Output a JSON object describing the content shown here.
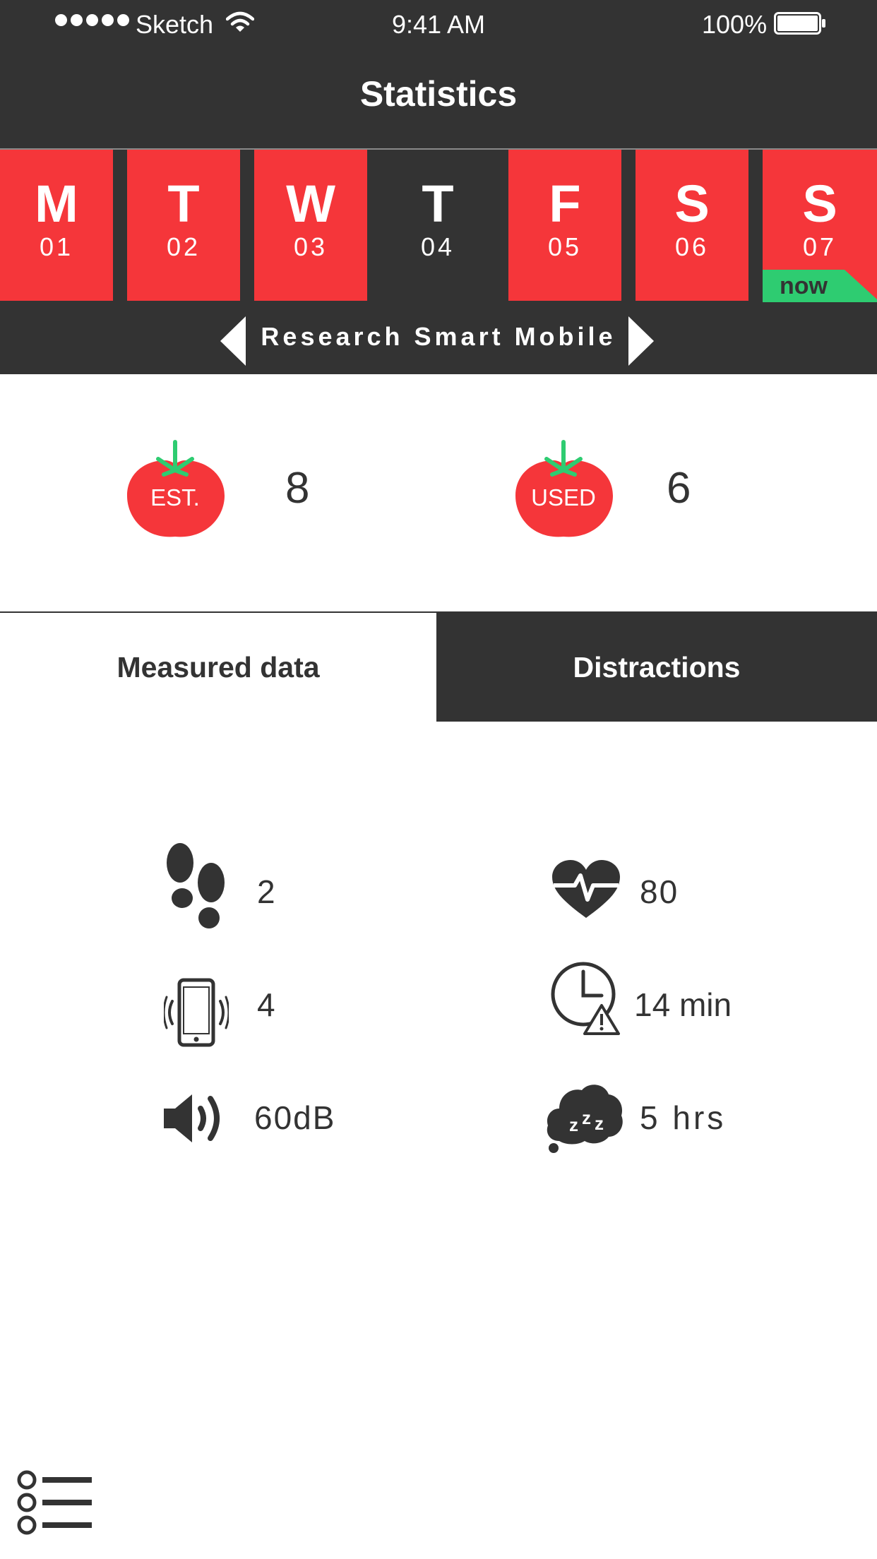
{
  "colors": {
    "dark": "#333333",
    "accent_red": "#f5363a",
    "now_green": "#2ecc71",
    "white": "#ffffff"
  },
  "status_bar": {
    "carrier": "Sketch",
    "time": "9:41 AM",
    "battery": "100%"
  },
  "header": {
    "title": "Statistics"
  },
  "days": [
    {
      "letter": "M",
      "num": "01",
      "completed": true
    },
    {
      "letter": "T",
      "num": "02",
      "completed": true
    },
    {
      "letter": "W",
      "num": "03",
      "completed": true
    },
    {
      "letter": "T",
      "num": "04",
      "completed": false
    },
    {
      "letter": "F",
      "num": "05",
      "completed": true
    },
    {
      "letter": "S",
      "num": "06",
      "completed": true
    },
    {
      "letter": "S",
      "num": "07",
      "completed": true
    }
  ],
  "now_label": "now",
  "project": {
    "name": "Research Smart Mobile"
  },
  "pomodoros": {
    "estimated": {
      "label": "EST.",
      "value": "8"
    },
    "used": {
      "label": "USED",
      "value": "6"
    }
  },
  "tabs": {
    "measured": "Measured data",
    "distractions": "Distractions"
  },
  "metrics": {
    "steps": "2",
    "heart_rate": "80",
    "phone_pickups": "4",
    "time_lost": "14 min",
    "noise": "60dB",
    "sleep": "5 hrs"
  },
  "icons": {
    "steps": "footprints-icon",
    "heart": "heartbeat-icon",
    "phone": "vibrating-phone-icon",
    "clock": "clock-warning-icon",
    "noise": "speaker-icon",
    "sleep": "sleep-cloud-icon",
    "menu": "list-menu-icon"
  }
}
